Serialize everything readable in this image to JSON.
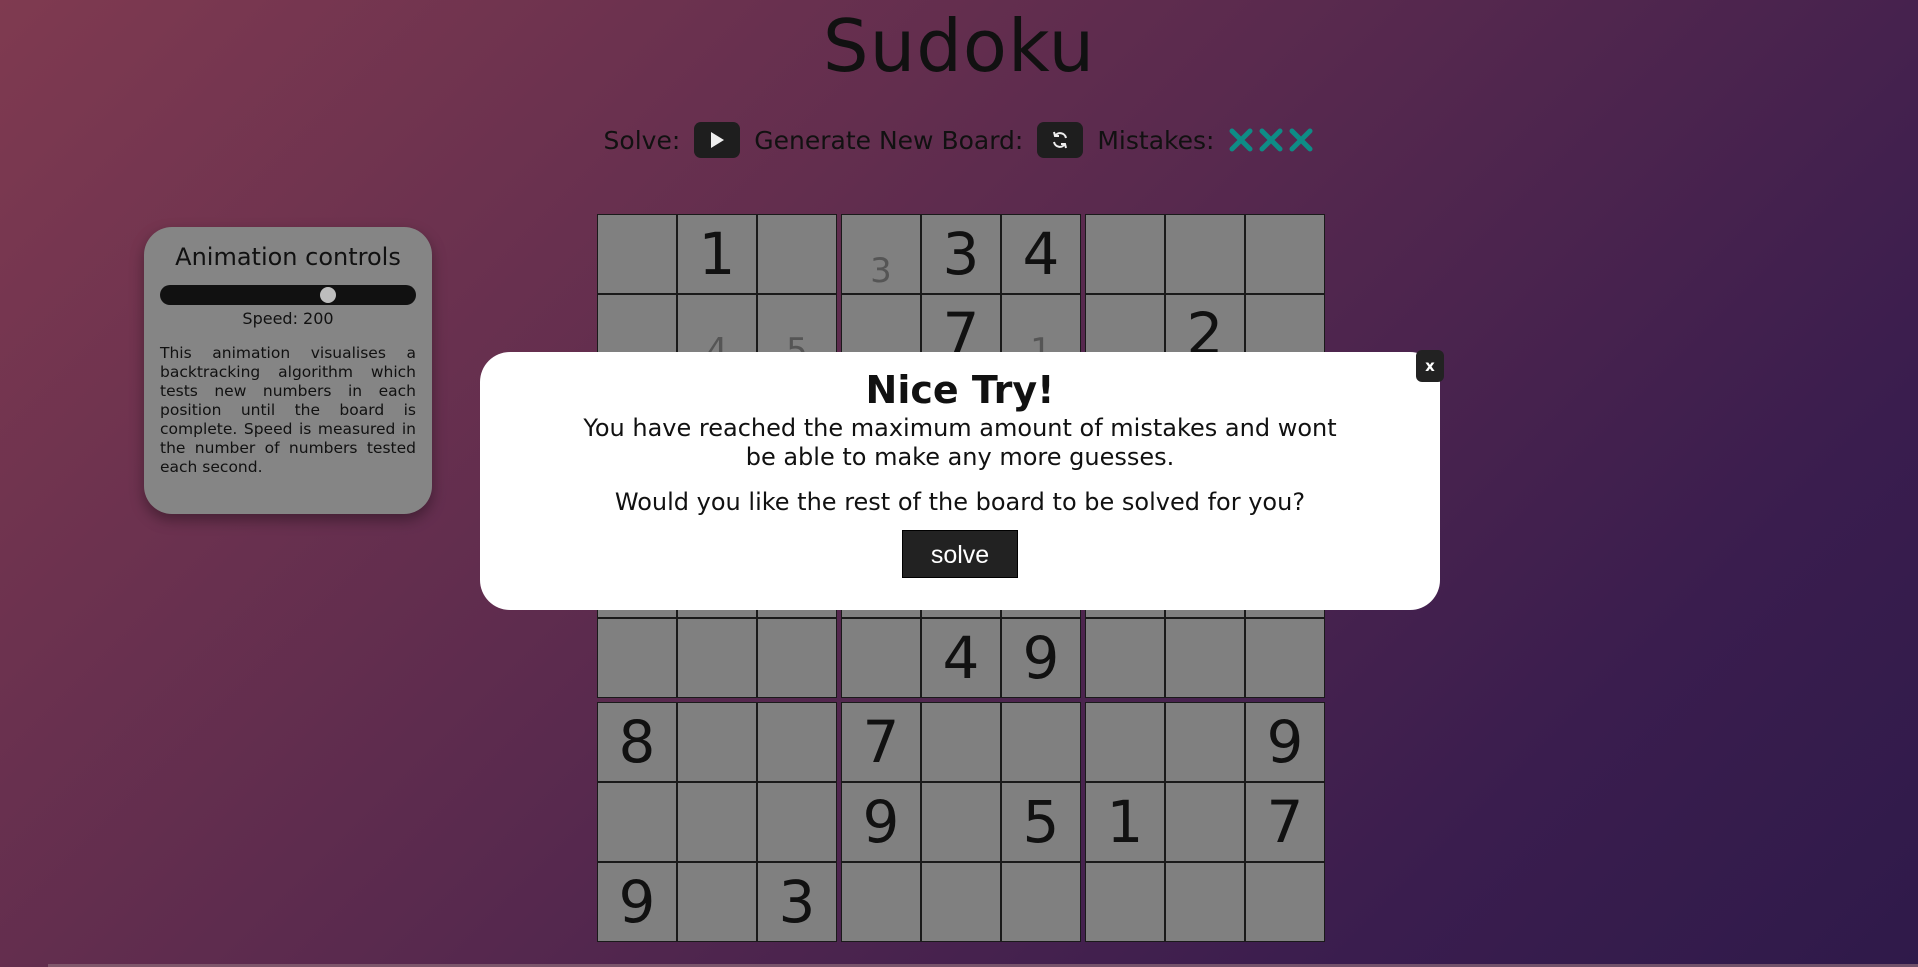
{
  "title": "Sudoku",
  "toolbar": {
    "solve_label": "Solve:",
    "generate_label": "Generate New Board:",
    "mistakes_label": "Mistakes:",
    "mistakes_count": 3,
    "mistake_color": "#0e8c86"
  },
  "animation_controls": {
    "title": "Animation controls",
    "speed_label": "Speed: 200",
    "speed_value": 200,
    "description": "This animation visualises a backtracking algorithm which tests new numbers in each position until the board is complete. Speed is measured in the number of numbers tested each second."
  },
  "board": {
    "rows": [
      [
        "",
        "1",
        "",
        "3n",
        "3",
        "4",
        "",
        "",
        ""
      ],
      [
        "",
        "4n",
        "5n",
        "",
        "7",
        "1n",
        "",
        "2",
        ""
      ],
      [
        "",
        "",
        "",
        "",
        "",
        "",
        "",
        "",
        ""
      ],
      [
        "",
        "",
        "",
        "",
        "",
        "",
        "",
        "",
        ""
      ],
      [
        "",
        "",
        "",
        "",
        "",
        "",
        "",
        "",
        ""
      ],
      [
        "",
        "",
        "",
        "",
        "4",
        "9",
        "",
        "",
        ""
      ],
      [
        "8",
        "",
        "",
        "7",
        "",
        "",
        "",
        "",
        "9"
      ],
      [
        "",
        "",
        "",
        "9",
        "",
        "5",
        "1",
        "",
        "7"
      ],
      [
        "9",
        "",
        "3",
        "",
        "",
        "",
        "",
        "",
        ""
      ]
    ]
  },
  "modal": {
    "heading": "Nice Try!",
    "message": "You have reached the maximum amount of mistakes and wont be able to make any more guesses.",
    "question": "Would you like the rest of the board to be solved for you?",
    "solve_button": "solve",
    "close_button": "x"
  }
}
